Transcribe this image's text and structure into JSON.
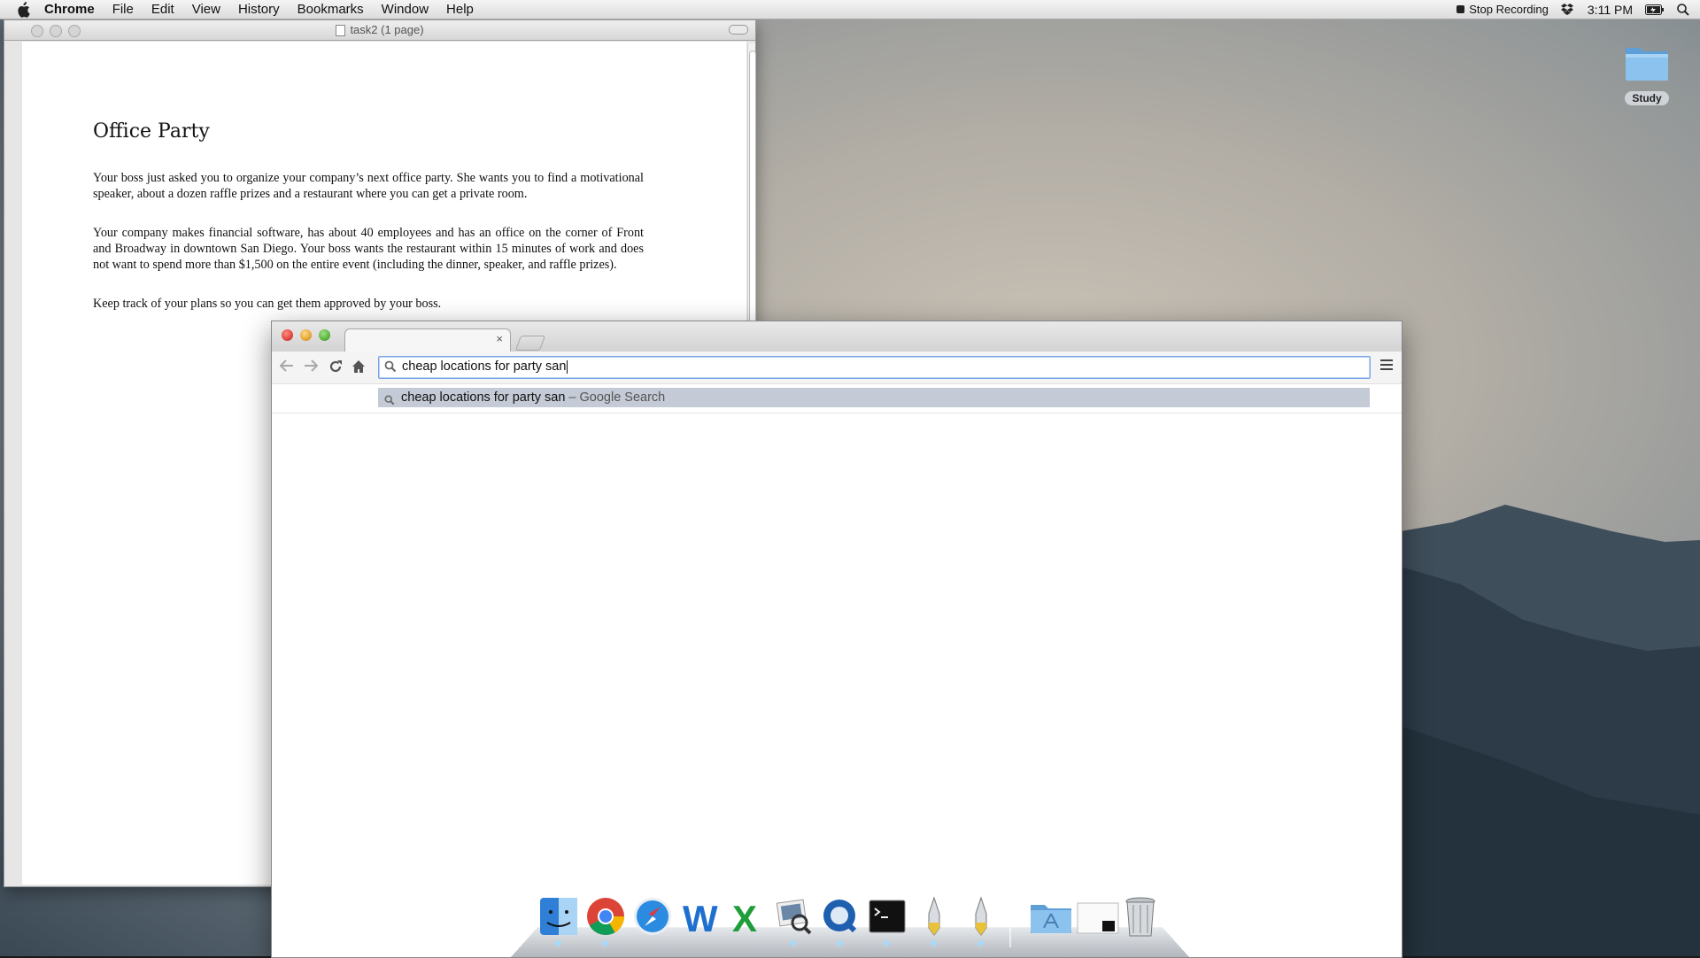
{
  "menubar": {
    "app_name": "Chrome",
    "menus": [
      "File",
      "Edit",
      "View",
      "History",
      "Bookmarks",
      "Window",
      "Help"
    ],
    "stop_recording": "Stop Recording",
    "clock": "3:11 PM"
  },
  "desktop": {
    "folder_label": "Study"
  },
  "preview": {
    "title": "task2 (1 page)",
    "doc_title": "Office Party",
    "paragraphs": [
      "Your boss just asked you to organize your company’s next office party. She wants you to find a motivational speaker, about a dozen raffle prizes and a restaurant where you can get a private room.",
      "Your company makes financial software, has about 40 employees and has an office on the corner of Front and Broadway in downtown San Diego. Your boss wants the restaurant within 15 minutes of work and does not want to spend more than $1,500 on the entire event (including the dinner, speaker, and raffle prizes).",
      "Keep track of your plans so you can get them approved by your boss."
    ]
  },
  "chrome": {
    "tab_close": "×",
    "omnibox_value": "cheap locations for party san",
    "suggestion_query": "cheap locations for party san",
    "suggestion_hint": " – Google Search"
  },
  "dock": {
    "items": [
      "finder-icon",
      "chrome-icon",
      "safari-icon",
      "word-icon",
      "excel-icon",
      "preview-icon",
      "quicktime-icon",
      "terminal-icon",
      "script-editor-icon",
      "script-editor-2-icon",
      "applications-folder-icon",
      "documents-icon",
      "trash-icon"
    ]
  },
  "colors": {
    "omnibox_focus": "#7aa5e6",
    "suggestion_highlight": "#c4cbd6"
  }
}
